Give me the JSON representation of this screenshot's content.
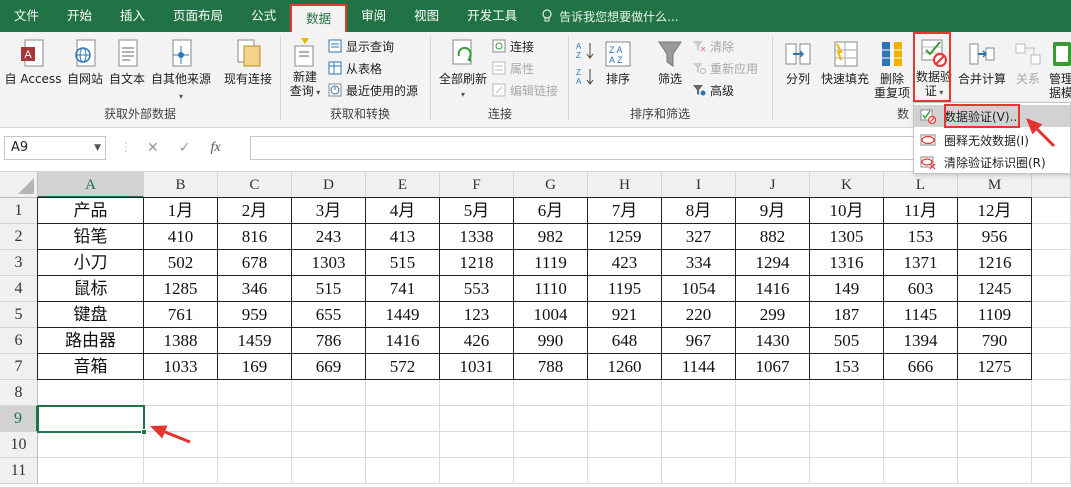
{
  "tabs": [
    {
      "label": "文件",
      "active": false
    },
    {
      "label": "开始",
      "active": false
    },
    {
      "label": "插入",
      "active": false
    },
    {
      "label": "页面布局",
      "active": false
    },
    {
      "label": "公式",
      "active": false
    },
    {
      "label": "数据",
      "active": true
    },
    {
      "label": "审阅",
      "active": false
    },
    {
      "label": "视图",
      "active": false
    },
    {
      "label": "开发工具",
      "active": false
    }
  ],
  "tell_me": "告诉我您想要做什么...",
  "ribbon": {
    "get_external": {
      "group_label": "获取外部数据",
      "from_access": "自 Access",
      "from_web": "自网站",
      "from_text": "自文本",
      "from_other": "自其他来源",
      "existing": "现有连接"
    },
    "transform": {
      "group_label": "获取和转换",
      "new_query_1": "新建",
      "new_query_2": "查询",
      "show_queries": "显示查询",
      "from_table": "从表格",
      "recent_sources": "最近使用的源"
    },
    "connections": {
      "group_label": "连接",
      "refresh_all": "全部刷新",
      "connections": "连接",
      "properties": "属性",
      "edit_links": "编辑链接"
    },
    "sort_filter": {
      "group_label": "排序和筛选",
      "sort": "排序",
      "filter": "筛选",
      "clear": "清除",
      "reapply": "重新应用",
      "advanced": "高级"
    },
    "tools": {
      "text_to_columns": "分列",
      "flash_fill": "快速填充",
      "remove_dup_1": "删除",
      "remove_dup_2": "重复项",
      "data_validation_1": "数据验",
      "data_validation_2": "证",
      "consolidate": "合并计算",
      "relationships": "关系",
      "manage_1": "管理",
      "manage_2": "据模",
      "group_label_partial": "数"
    }
  },
  "dropdown": {
    "items": [
      {
        "label": "数据验证(V)..."
      },
      {
        "label": "圈释无效数据(I)"
      },
      {
        "label": "清除验证标识圈(R)"
      }
    ]
  },
  "formula_bar": {
    "name_box": "A9",
    "cancel": "✕",
    "enter": "✓",
    "fx": "fx",
    "content": ""
  },
  "sheet": {
    "columns": [
      "A",
      "B",
      "C",
      "D",
      "E",
      "F",
      "G",
      "H",
      "I",
      "J",
      "K",
      "L",
      "M"
    ],
    "row_numbers": [
      "1",
      "2",
      "3",
      "4",
      "5",
      "6",
      "7",
      "8",
      "9",
      "10",
      "11"
    ],
    "rows": [
      [
        "产品",
        "1月",
        "2月",
        "3月",
        "4月",
        "5月",
        "6月",
        "7月",
        "8月",
        "9月",
        "10月",
        "11月",
        "12月"
      ],
      [
        "铅笔",
        "410",
        "816",
        "243",
        "413",
        "1338",
        "982",
        "1259",
        "327",
        "882",
        "1305",
        "153",
        "956"
      ],
      [
        "小刀",
        "502",
        "678",
        "1303",
        "515",
        "1218",
        "1119",
        "423",
        "334",
        "1294",
        "1316",
        "1371",
        "1216"
      ],
      [
        "鼠标",
        "1285",
        "346",
        "515",
        "741",
        "553",
        "1110",
        "1195",
        "1054",
        "1416",
        "149",
        "603",
        "1245"
      ],
      [
        "键盘",
        "761",
        "959",
        "655",
        "1449",
        "123",
        "1004",
        "921",
        "220",
        "299",
        "187",
        "1145",
        "1109"
      ],
      [
        "路由器",
        "1388",
        "1459",
        "786",
        "1416",
        "426",
        "990",
        "648",
        "967",
        "1430",
        "505",
        "1394",
        "790"
      ],
      [
        "音箱",
        "1033",
        "169",
        "669",
        "572",
        "1031",
        "788",
        "1260",
        "1144",
        "1067",
        "153",
        "666",
        "1275"
      ]
    ],
    "selected_cell": "A9"
  },
  "colors": {
    "accent": "#217346",
    "highlight": "#e33333"
  }
}
